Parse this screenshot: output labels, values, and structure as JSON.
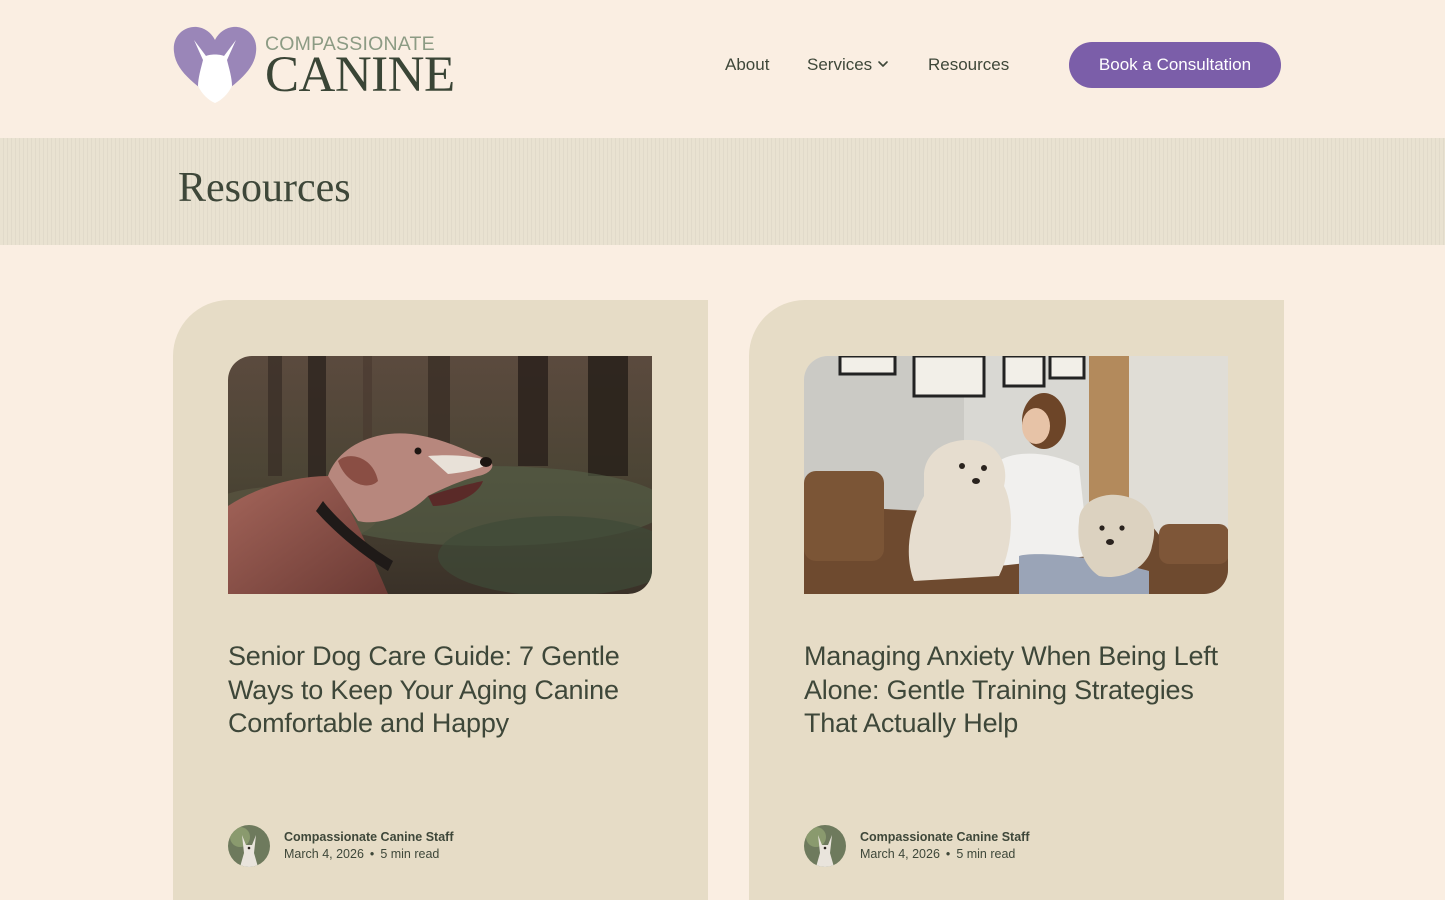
{
  "header": {
    "logo": {
      "line1": "COMPASSIONATE",
      "line2": "CANINE"
    },
    "nav": [
      {
        "label": "About"
      },
      {
        "label": "Services",
        "has_dropdown": true
      },
      {
        "label": "Resources"
      }
    ],
    "cta_label": "Book a Consultation"
  },
  "page": {
    "title": "Resources"
  },
  "articles": [
    {
      "title": "Senior Dog Care Guide: 7 Gentle Ways to Keep Your Aging Canine Comfortable and Happy",
      "author": "Compassionate Canine Staff",
      "date": "March 4, 2026",
      "separator": "•",
      "read_time": "5 min read"
    },
    {
      "title": "Managing Anxiety When Being Left Alone: Gentle Training Strategies That Actually Help",
      "author": "Compassionate Canine Staff",
      "date": "March 4, 2026",
      "separator": "•",
      "read_time": "5 min read"
    }
  ],
  "colors": {
    "background": "#faeee2",
    "band": "#e9e2d1",
    "card": "#e6dcc6",
    "accent": "#7b5ea9",
    "text": "#3e4739",
    "logo_small_text": "#8c9b84",
    "logo_heart": "#9a86b8"
  },
  "icons": {
    "logo_mark": "heart-dog-silhouette-icon",
    "services_dropdown": "chevron-down-icon"
  }
}
